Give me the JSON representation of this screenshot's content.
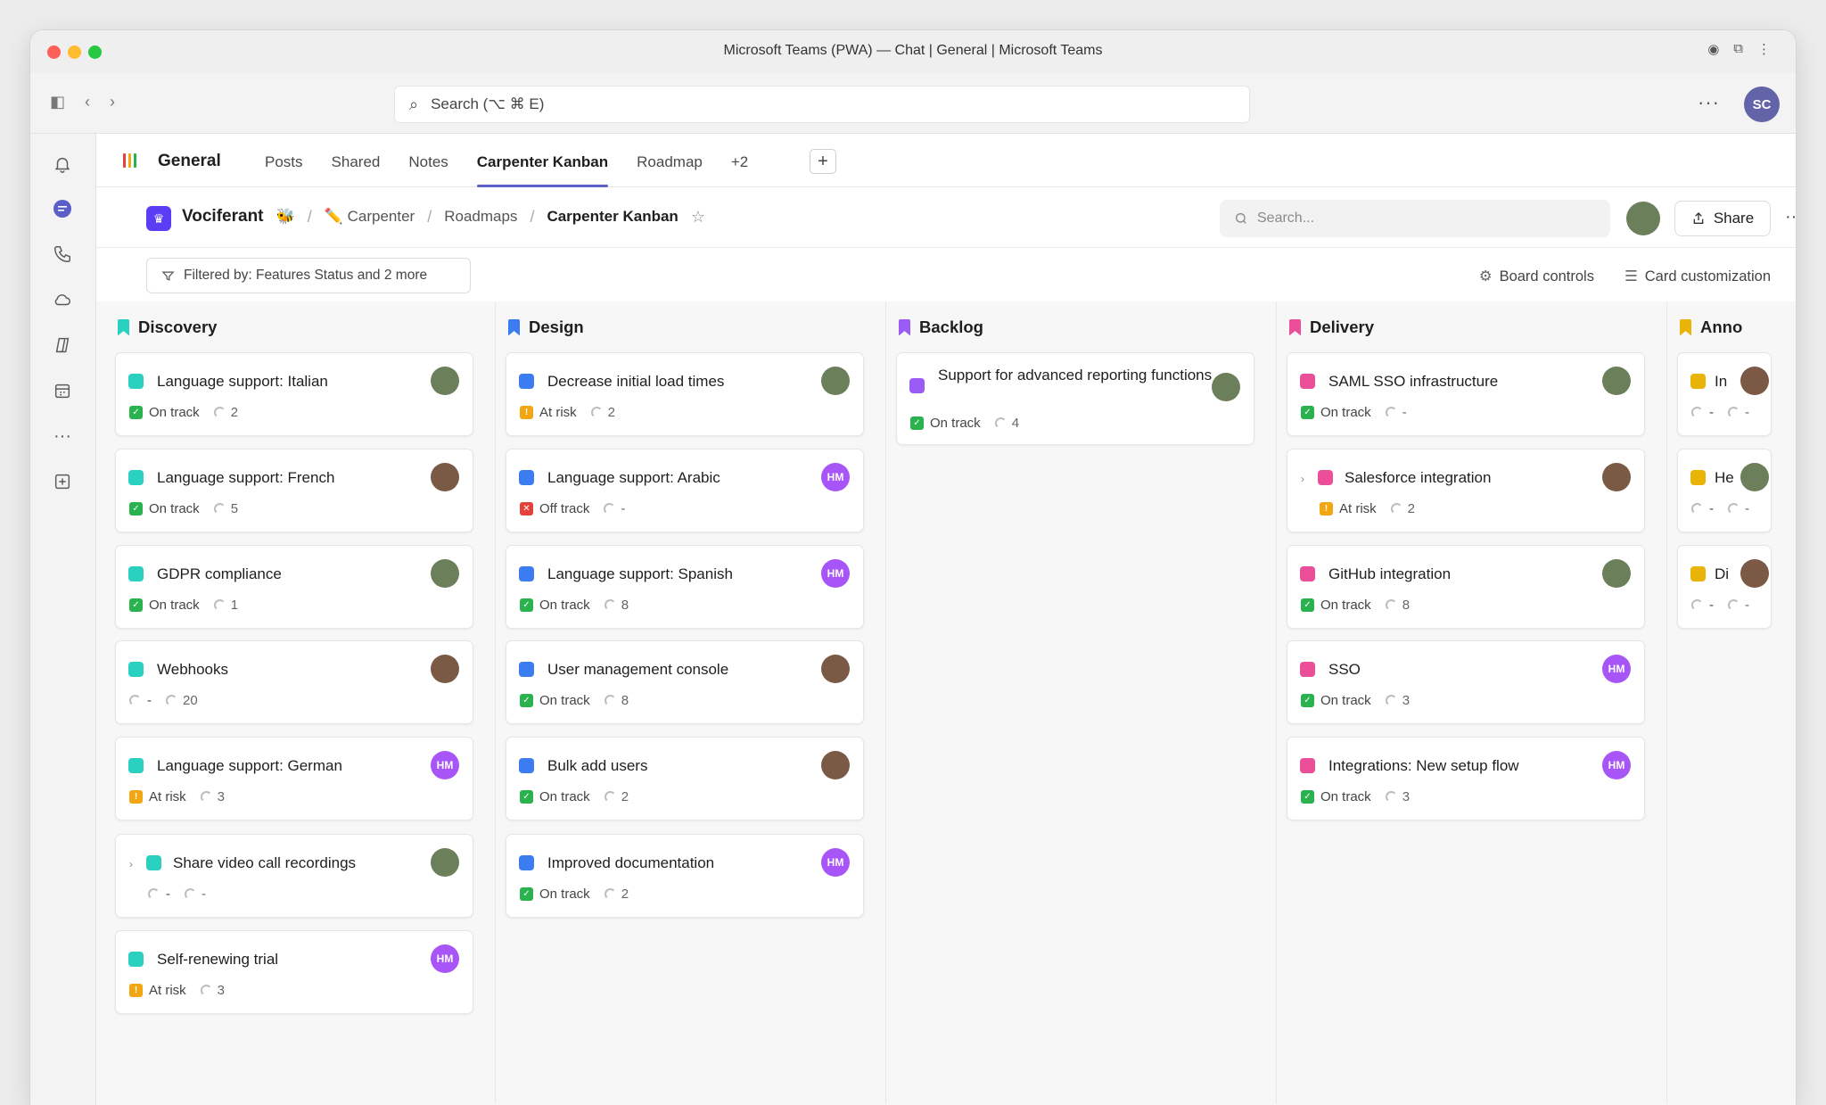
{
  "window": {
    "title": "Microsoft Teams (PWA) — Chat | General | Microsoft Teams"
  },
  "appbar": {
    "search_placeholder": "Search (⌥ ⌘ E)",
    "user_initials": "SC",
    "more_label": "···"
  },
  "rail": {
    "icons": [
      "bell-icon",
      "chat-icon",
      "phone-icon",
      "cloud-icon",
      "copilot-icon",
      "calendar-icon",
      "more-icon",
      "add-app-icon"
    ]
  },
  "channel": {
    "title": "General",
    "tabs": [
      {
        "label": "Posts",
        "active": false
      },
      {
        "label": "Shared",
        "active": false
      },
      {
        "label": "Notes",
        "active": false
      },
      {
        "label": "Carpenter Kanban",
        "active": true
      },
      {
        "label": "Roadmap",
        "active": false
      },
      {
        "label": "+2",
        "active": false
      }
    ],
    "add_label": "+"
  },
  "breadcrumb": {
    "workspace": "Vociferant",
    "workspace_emoji": "🐝",
    "items": [
      "✏️ Carpenter",
      "Roadmaps",
      "Carpenter Kanban"
    ],
    "separator": "/",
    "search_placeholder": "Search...",
    "share_label": "Share"
  },
  "filter": {
    "label": "Filtered by: Features Status and 2 more"
  },
  "board_controls": {
    "board_label": "Board controls",
    "card_label": "Card customization"
  },
  "colors": {
    "discovery": "#2ad0c0",
    "design": "#3b7cf0",
    "backlog": "#9a5cf5",
    "delivery": "#ec4f9a",
    "announce": "#eab308",
    "avatar_green": "#6b7f5a",
    "avatar_brown": "#7a5a45",
    "avatar_hm": "#a855f7"
  },
  "columns": [
    {
      "name": "Discovery",
      "color": "#2ad0c0",
      "cards": [
        {
          "title": "Language support: Italian",
          "status": "On track",
          "progress": "2",
          "avatar": "green"
        },
        {
          "title": "Language support: French",
          "status": "On track",
          "progress": "5",
          "avatar": "brown"
        },
        {
          "title": "GDPR compliance",
          "status": "On track",
          "progress": "1",
          "avatar": "green"
        },
        {
          "title": "Webhooks",
          "status": "-",
          "progress": "20",
          "avatar": "brown"
        },
        {
          "title": "Language support: German",
          "status": "At risk",
          "progress": "3",
          "avatar": "HM"
        },
        {
          "title": "Share video call recordings",
          "status": "-",
          "progress": "-",
          "avatar": "green",
          "expandable": true
        },
        {
          "title": "Self-renewing trial",
          "status": "At risk",
          "progress": "3",
          "avatar": "HM"
        }
      ]
    },
    {
      "name": "Design",
      "color": "#3b7cf0",
      "cards": [
        {
          "title": "Decrease initial load times",
          "status": "At risk",
          "progress": "2",
          "avatar": "green"
        },
        {
          "title": "Language support: Arabic",
          "status": "Off track",
          "progress": "-",
          "avatar": "HM"
        },
        {
          "title": "Language support: Spanish",
          "status": "On track",
          "progress": "8",
          "avatar": "HM"
        },
        {
          "title": "User management console",
          "status": "On track",
          "progress": "8",
          "avatar": "brown"
        },
        {
          "title": "Bulk add users",
          "status": "On track",
          "progress": "2",
          "avatar": "brown"
        },
        {
          "title": "Improved documentation",
          "status": "On track",
          "progress": "2",
          "avatar": "HM"
        }
      ]
    },
    {
      "name": "Backlog",
      "color": "#9a5cf5",
      "cards": [
        {
          "title": "Support for advanced reporting functions",
          "status": "On track",
          "progress": "4",
          "avatar": "green",
          "tall": true
        }
      ]
    },
    {
      "name": "Delivery",
      "color": "#ec4f9a",
      "cards": [
        {
          "title": "SAML SSO infrastructure",
          "status": "On track",
          "progress": "-",
          "avatar": "green"
        },
        {
          "title": "Salesforce integration",
          "status": "At risk",
          "progress": "2",
          "avatar": "brown",
          "expandable": true
        },
        {
          "title": "GitHub integration",
          "status": "On track",
          "progress": "8",
          "avatar": "green"
        },
        {
          "title": "SSO",
          "status": "On track",
          "progress": "3",
          "avatar": "HM"
        },
        {
          "title": "Integrations: New setup flow",
          "status": "On track",
          "progress": "3",
          "avatar": "HM"
        }
      ]
    },
    {
      "name": "Anno",
      "color": "#eab308",
      "partial": true,
      "cards": [
        {
          "title": "In",
          "status": "-",
          "progress": "-",
          "avatar": "brown"
        },
        {
          "title": "He",
          "status": "-",
          "progress": "-",
          "avatar": "green"
        },
        {
          "title": "Di",
          "status": "-",
          "progress": "-",
          "avatar": "brown"
        }
      ]
    }
  ]
}
